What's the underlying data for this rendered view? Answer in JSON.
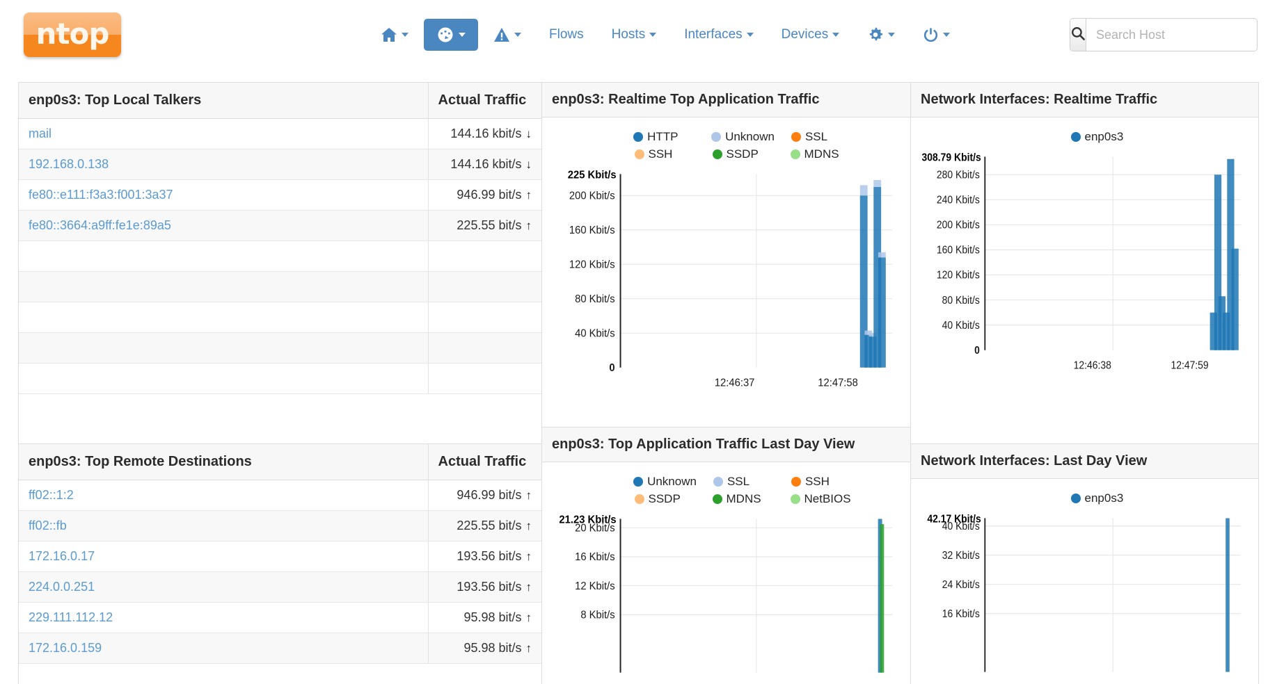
{
  "header": {
    "logo_text": "ntop",
    "nav": [
      {
        "id": "home",
        "label": "",
        "icon": "home-icon",
        "caret": true,
        "active": false
      },
      {
        "id": "dashboard",
        "label": "",
        "icon": "dashboard-gauge-icon",
        "caret": true,
        "active": true
      },
      {
        "id": "alerts",
        "label": "",
        "icon": "warning-triangle-icon",
        "caret": true,
        "active": false
      },
      {
        "id": "flows",
        "label": "Flows",
        "icon": "",
        "caret": false,
        "active": false
      },
      {
        "id": "hosts",
        "label": "Hosts",
        "icon": "",
        "caret": true,
        "active": false
      },
      {
        "id": "interfaces",
        "label": "Interfaces",
        "icon": "",
        "caret": true,
        "active": false
      },
      {
        "id": "devices",
        "label": "Devices",
        "icon": "",
        "caret": true,
        "active": false
      },
      {
        "id": "settings",
        "label": "",
        "icon": "gear-icon",
        "caret": true,
        "active": false
      },
      {
        "id": "power",
        "label": "",
        "icon": "power-icon",
        "caret": true,
        "active": false
      }
    ],
    "search": {
      "placeholder": "Search Host",
      "value": "",
      "icon": "search-icon"
    }
  },
  "tables": {
    "local_talkers": {
      "title": "enp0s3: Top Local Talkers",
      "traffic_header": "Actual Traffic",
      "rows": [
        {
          "host": "mail",
          "traffic": "144.16 kbit/s",
          "direction": "down"
        },
        {
          "host": "192.168.0.138",
          "traffic": "144.16 kbit/s",
          "direction": "down"
        },
        {
          "host": "fe80::e111:f3a3:f001:3a37",
          "traffic": "946.99 bit/s",
          "direction": "up"
        },
        {
          "host": "fe80::3664:a9ff:fe1e:89a5",
          "traffic": "225.55 bit/s",
          "direction": "up"
        },
        {
          "host": "",
          "traffic": "",
          "direction": ""
        },
        {
          "host": "",
          "traffic": "",
          "direction": ""
        },
        {
          "host": "",
          "traffic": "",
          "direction": ""
        },
        {
          "host": "",
          "traffic": "",
          "direction": ""
        },
        {
          "host": "",
          "traffic": "",
          "direction": ""
        }
      ]
    },
    "remote_destinations": {
      "title": "enp0s3: Top Remote Destinations",
      "traffic_header": "Actual Traffic",
      "rows": [
        {
          "host": "ff02::1:2",
          "traffic": "946.99 bit/s",
          "direction": "up"
        },
        {
          "host": "ff02::fb",
          "traffic": "225.55 bit/s",
          "direction": "up"
        },
        {
          "host": "172.16.0.17",
          "traffic": "193.56 bit/s",
          "direction": "up"
        },
        {
          "host": "224.0.0.251",
          "traffic": "193.56 bit/s",
          "direction": "up"
        },
        {
          "host": "229.111.112.12",
          "traffic": "95.98 bit/s",
          "direction": "up"
        },
        {
          "host": "172.16.0.159",
          "traffic": "95.98 bit/s",
          "direction": "up"
        }
      ]
    }
  },
  "arrows": {
    "up": "↑",
    "down": "↓"
  },
  "chart_data": [
    {
      "id": "rt_app_traffic",
      "type": "bar",
      "title": "enp0s3: Realtime Top Application Traffic",
      "xlabel": "",
      "ylabel": "",
      "max_label": "225 Kbit/s",
      "ylim": [
        0,
        225
      ],
      "yticks": [
        0,
        40,
        80,
        120,
        160,
        200
      ],
      "ytick_labels": [
        "0",
        "40 Kbit/s",
        "80 Kbit/s",
        "120 Kbit/s",
        "160 Kbit/s",
        "200 Kbit/s"
      ],
      "xticks": [
        "12:46:37",
        "12:47:58"
      ],
      "grid": true,
      "legend_position": "top",
      "legend": [
        {
          "name": "HTTP",
          "color": "#1f77b4"
        },
        {
          "name": "Unknown",
          "color": "#aec7e8"
        },
        {
          "name": "SSL",
          "color": "#ff7f0e"
        },
        {
          "name": "SSH",
          "color": "#ffbb78"
        },
        {
          "name": "SSDP",
          "color": "#2ca02c"
        },
        {
          "name": "MDNS",
          "color": "#98df8a"
        }
      ],
      "bars": [
        {
          "x": 0.895,
          "values": [
            {
              "series": "HTTP",
              "value": 200
            },
            {
              "series": "Unknown",
              "value": 12
            }
          ]
        },
        {
          "x": 0.912,
          "values": [
            {
              "series": "HTTP",
              "value": 38
            },
            {
              "series": "Unknown",
              "value": 5
            }
          ]
        },
        {
          "x": 0.928,
          "values": [
            {
              "series": "HTTP",
              "value": 36
            },
            {
              "series": "Unknown",
              "value": 4
            }
          ]
        },
        {
          "x": 0.945,
          "values": [
            {
              "series": "HTTP",
              "value": 210
            },
            {
              "series": "Unknown",
              "value": 8
            }
          ]
        },
        {
          "x": 0.962,
          "values": [
            {
              "series": "HTTP",
              "value": 128
            },
            {
              "series": "Unknown",
              "value": 6
            }
          ]
        }
      ]
    },
    {
      "id": "rt_net_interfaces",
      "type": "bar",
      "title": "Network Interfaces: Realtime Traffic",
      "xlabel": "",
      "ylabel": "",
      "max_label": "308.79 Kbit/s",
      "ylim": [
        0,
        308.79
      ],
      "yticks": [
        0,
        40,
        80,
        120,
        160,
        200,
        240,
        280
      ],
      "ytick_labels": [
        "0",
        "40 Kbit/s",
        "80 Kbit/s",
        "120 Kbit/s",
        "160 Kbit/s",
        "200 Kbit/s",
        "240 Kbit/s",
        "280 Kbit/s"
      ],
      "xticks": [
        "12:46:38",
        "12:47:59"
      ],
      "grid": true,
      "legend_position": "top",
      "legend": [
        {
          "name": "enp0s3",
          "color": "#1f77b4"
        }
      ],
      "bars": [
        {
          "x": 0.893,
          "values": [
            {
              "series": "enp0s3",
              "value": 60
            }
          ]
        },
        {
          "x": 0.91,
          "values": [
            {
              "series": "enp0s3",
              "value": 280
            }
          ]
        },
        {
          "x": 0.926,
          "values": [
            {
              "series": "enp0s3",
              "value": 86
            }
          ]
        },
        {
          "x": 0.943,
          "values": [
            {
              "series": "enp0s3",
              "value": 60
            }
          ]
        },
        {
          "x": 0.96,
          "values": [
            {
              "series": "enp0s3",
              "value": 305
            }
          ]
        },
        {
          "x": 0.977,
          "values": [
            {
              "series": "enp0s3",
              "value": 162
            }
          ]
        }
      ]
    },
    {
      "id": "day_app_traffic",
      "type": "area",
      "title": "enp0s3: Top Application Traffic Last Day View",
      "xlabel": "",
      "ylabel": "",
      "max_label": "21.23 Kbit/s",
      "ylim": [
        0,
        21.23
      ],
      "yticks": [
        8,
        12,
        16,
        20
      ],
      "ytick_labels": [
        "8 Kbit/s",
        "12 Kbit/s",
        "16 Kbit/s",
        "20 Kbit/s"
      ],
      "xticks": [],
      "grid": true,
      "legend_position": "top",
      "legend": [
        {
          "name": "Unknown",
          "color": "#1f77b4"
        },
        {
          "name": "SSL",
          "color": "#aec7e8"
        },
        {
          "name": "SSH",
          "color": "#ff7f0e"
        },
        {
          "name": "SSDP",
          "color": "#ffbb78"
        },
        {
          "name": "MDNS",
          "color": "#2ca02c"
        },
        {
          "name": "NetBIOS",
          "color": "#98df8a"
        }
      ],
      "spikes": [
        {
          "x": 0.955,
          "value": 21.23,
          "series": "Unknown"
        },
        {
          "x": 0.962,
          "value": 20.5,
          "series": "MDNS"
        }
      ]
    },
    {
      "id": "day_net_interfaces",
      "type": "area",
      "title": "Network Interfaces: Last Day View",
      "xlabel": "",
      "ylabel": "",
      "max_label": "42.17 Kbit/s",
      "ylim": [
        0,
        42.17
      ],
      "yticks": [
        16,
        24,
        32,
        40
      ],
      "ytick_labels": [
        "16 Kbit/s",
        "24 Kbit/s",
        "32 Kbit/s",
        "40 Kbit/s"
      ],
      "xticks": [],
      "grid": true,
      "legend_position": "top",
      "legend": [
        {
          "name": "enp0s3",
          "color": "#1f77b4"
        }
      ],
      "spikes": [
        {
          "x": 0.948,
          "value": 42.17,
          "series": "enp0s3"
        }
      ]
    }
  ]
}
